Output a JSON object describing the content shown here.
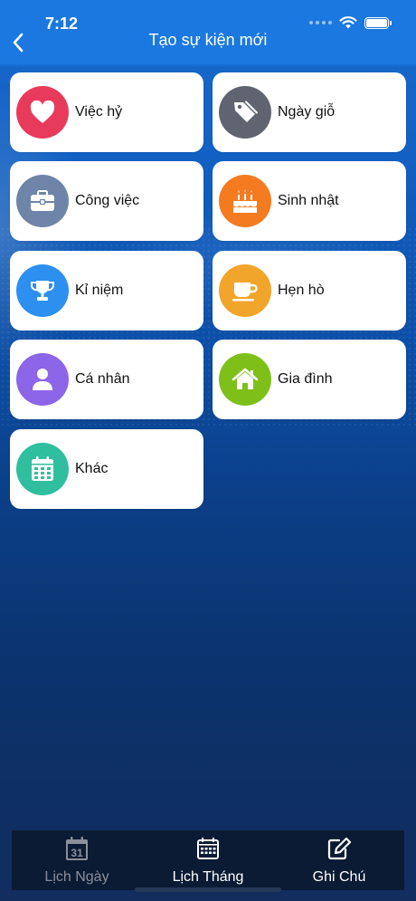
{
  "status_bar": {
    "time": "7:12"
  },
  "header": {
    "title": "Tạo sự kiện mới",
    "back_icon": "chevron-left-icon"
  },
  "event_types": [
    {
      "label": "Việc hỷ",
      "icon": "heart-icon",
      "color": "#e83b5b"
    },
    {
      "label": "Ngày giỗ",
      "icon": "tag-icon",
      "color": "#5f6470"
    },
    {
      "label": "Công việc",
      "icon": "briefcase-icon",
      "color": "#6e84a8"
    },
    {
      "label": "Sinh nhật",
      "icon": "birthday-cake-icon",
      "color": "#f47b20"
    },
    {
      "label": "Kỉ niệm",
      "icon": "trophy-icon",
      "color": "#2d8ff0"
    },
    {
      "label": "Hẹn hò",
      "icon": "coffee-cup-icon",
      "color": "#f2a52b"
    },
    {
      "label": "Cá nhân",
      "icon": "user-icon",
      "color": "#8c65e8"
    },
    {
      "label": "Gia đình",
      "icon": "home-icon",
      "color": "#7fbf1a"
    },
    {
      "label": "Khác",
      "icon": "calendar-icon",
      "color": "#2fbf9f"
    }
  ],
  "tabbar": {
    "items": [
      {
        "label": "Lịch Ngày",
        "icon": "calendar-day-icon",
        "icon_text": "31",
        "active": false
      },
      {
        "label": "Lịch Tháng",
        "icon": "calendar-month-icon",
        "active": true
      },
      {
        "label": "Ghi Chú",
        "icon": "note-edit-icon",
        "active": true
      }
    ]
  }
}
